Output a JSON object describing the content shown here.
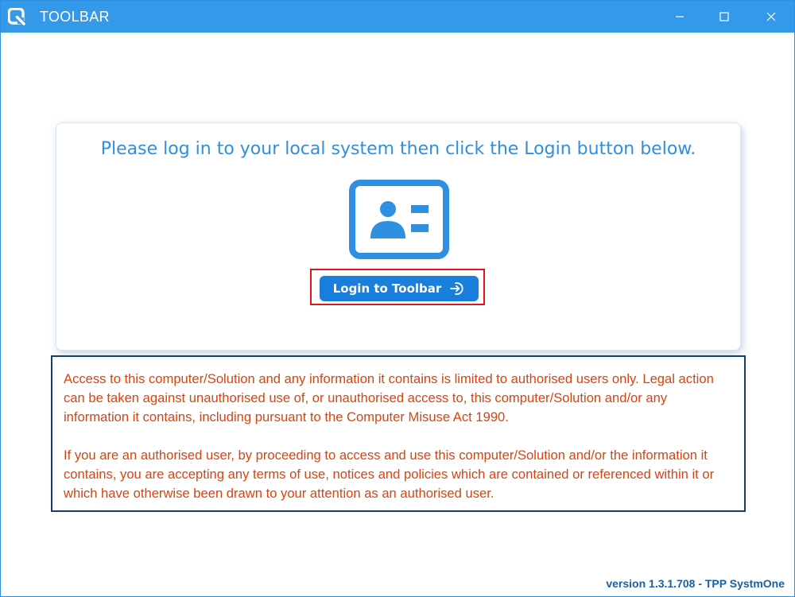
{
  "window": {
    "title": "TOOLBAR",
    "logo_icon": "q-logo-icon",
    "controls": [
      "minimize-icon",
      "maximize-icon",
      "close-icon"
    ]
  },
  "login_card": {
    "prompt": "Please log in to your local system then click the Login button below.",
    "illustration_icon": "id-card-icon",
    "login_button": {
      "label": "Login to Toolbar",
      "icon": "login-arrow-icon"
    }
  },
  "notice": {
    "paragraph1": "Access to this computer/Solution and any information it contains is limited to authorised users only. Legal action can be taken against unauthorised use of, or unauthorised access to, this computer/Solution and/or any information it contains, including pursuant to the Computer Misuse Act 1990.",
    "paragraph2": "If you are an authorised user, by proceeding to access and use this computer/Solution and/or the information it contains, you are accepting any terms of use, notices and policies which are contained or referenced within it or which have otherwise been drawn to your attention as an authorised user."
  },
  "footer": {
    "version": "version 1.3.1.708 - TPP SystmOne"
  },
  "colors": {
    "titlebar": "#3399e8",
    "accent": "#2f8fe0",
    "button": "#1a7fdc",
    "highlight": "#e0161e",
    "notice_text": "#d9430f",
    "notice_border": "#123e6b",
    "version_text": "#1a5fa0"
  }
}
